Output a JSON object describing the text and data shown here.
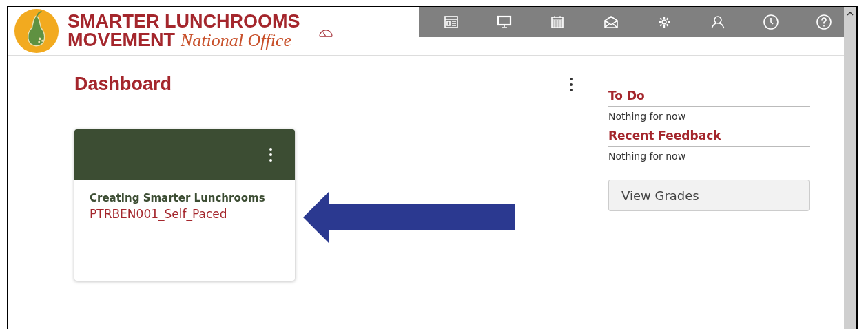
{
  "header": {
    "logo_line_1": "SMARTER LUNCHROOMS",
    "logo_line_2": "MOVEMENT",
    "logo_script": "National Office"
  },
  "main": {
    "title": "Dashboard",
    "cards": [
      {
        "title": "Creating Smarter Lunchrooms",
        "subtitle": "PTRBEN001_Self_Paced"
      }
    ]
  },
  "sidebar": {
    "sections": [
      {
        "heading": "To Do",
        "text": "Nothing for now"
      },
      {
        "heading": "Recent Feedback",
        "text": "Nothing for now"
      }
    ],
    "button": "View Grades"
  }
}
